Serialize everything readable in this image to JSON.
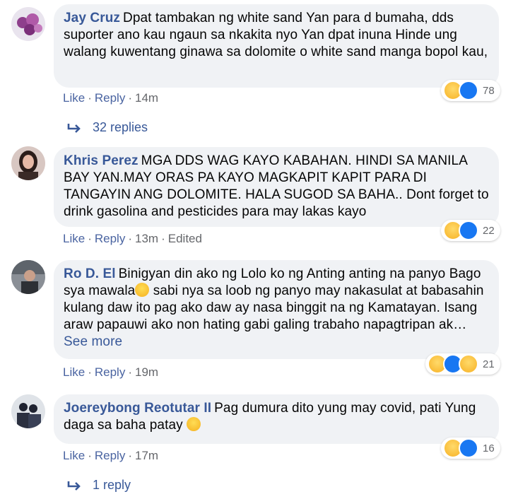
{
  "comments": [
    {
      "name": "Jay Cruz",
      "text": "Dpat tambakan ng white sand Yan para d bumaha, dds suporter ano kau ngaun sa nkakita nyo Yan dpat inuna Hinde ung walang kuwentang ginawa sa dolomite o white sand manga bopol kau,",
      "like": "Like",
      "reply": "Reply",
      "time": "14m",
      "edited": "",
      "reaction_count": "78",
      "reactions": [
        "haha-icon",
        "like-icon"
      ],
      "replies": "32 replies"
    },
    {
      "name": "Khris Perez",
      "text": "MGA DDS WAG KAYO KABAHAN. HINDI SA MANILA BAY YAN.MAY ORAS PA KAYO MAGKAPIT KAPIT PARA DI TANGAYIN ANG DOLOMITE. HALA SUGOD SA BAHA.. Dont forget to drink gasolina and pesticides para may lakas kayo",
      "like": "Like",
      "reply": "Reply",
      "time": "13m",
      "edited": "Edited",
      "reaction_count": "22",
      "reactions": [
        "haha-icon",
        "like-icon"
      ]
    },
    {
      "name": "Ro D. El",
      "text_a": "Binigyan din ako ng Lolo ko ng Anting anting na panyo Bago sya mawala",
      "text_b": " sabi nya sa loob ng panyo may nakasulat at babasahin kulang daw ito pag ako daw ay nasa binggit na ng Kamatayan. Isang araw papauwi ako non hating gabi galing trabaho napagtripan ak…",
      "see_more": "See more",
      "like": "Like",
      "reply": "Reply",
      "time": "19m",
      "reaction_count": "21",
      "reactions": [
        "haha-icon",
        "like-icon",
        "sad-icon"
      ]
    },
    {
      "name": "Joereybong Reotutar II",
      "text": "Pag dumura dito yung may covid, pati Yung daga sa baha patay",
      "like": "Like",
      "reply": "Reply",
      "time": "17m",
      "reaction_count": "16",
      "reactions": [
        "haha-icon",
        "like-icon"
      ],
      "replies": "1 reply"
    }
  ],
  "colors": {
    "name": "#385898",
    "bubble": "#f0f2f5",
    "meta": "#65676b",
    "like_blue": "#1877f2"
  }
}
